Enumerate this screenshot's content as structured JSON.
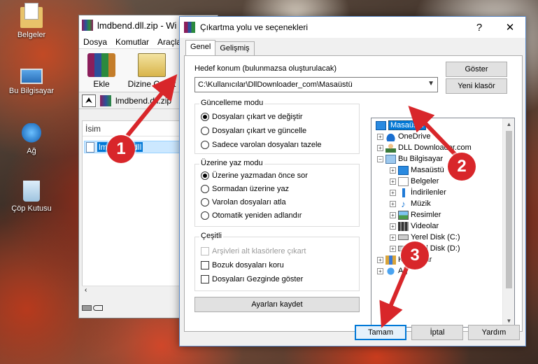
{
  "desktop": {
    "icons": [
      {
        "label": "Belgeler",
        "icon": "documents-folder-icon"
      },
      {
        "label": "Bu Bilgisayar",
        "icon": "this-pc-icon"
      },
      {
        "label": "Ağ",
        "icon": "network-icon"
      },
      {
        "label": "Çöp Kutusu",
        "icon": "recycle-bin-icon"
      }
    ]
  },
  "winrar": {
    "title": "lmdbend.dll.zip - Wi",
    "menu": [
      "Dosya",
      "Komutlar",
      "Araçla"
    ],
    "toolbar": {
      "add_label": "Ekle",
      "extract_label": "Dizine Çıkart"
    },
    "path": "lmdbend.dll.zip",
    "column_name": "İsim",
    "file": "lmdbend.dll"
  },
  "dialog": {
    "title": "Çıkartma yolu ve seçenekleri",
    "help_glyph": "?",
    "close_glyph": "✕",
    "tabs": [
      "Genel",
      "Gelişmiş"
    ],
    "destination": {
      "label": "Hedef konum (bulunmazsa oluşturulacak)",
      "value": "C:\\Kullanıcılar\\DllDownloader_com\\Masaüstü"
    },
    "buttons": {
      "show": "Göster",
      "new_folder": "Yeni klasör",
      "save_settings": "Ayarları kaydet",
      "ok": "Tamam",
      "cancel": "İptal",
      "help": "Yardım"
    },
    "update_mode": {
      "title": "Güncelleme modu",
      "options": [
        {
          "label": "Dosyaları çıkart ve değiştir",
          "selected": true
        },
        {
          "label": "Dosyaları çıkart ve güncelle",
          "selected": false
        },
        {
          "label": "Sadece varolan dosyaları tazele",
          "selected": false
        }
      ]
    },
    "overwrite_mode": {
      "title": "Üzerine yaz modu",
      "options": [
        {
          "label": "Üzerine yazmadan önce sor",
          "selected": true
        },
        {
          "label": "Sormadan üzerine yaz",
          "selected": false
        },
        {
          "label": "Varolan dosyaları atla",
          "selected": false
        },
        {
          "label": "Otomatik yeniden adlandır",
          "selected": false
        }
      ]
    },
    "misc": {
      "title": "Çeşitli",
      "options": [
        {
          "label": "Arşivleri alt klasörlere çıkart",
          "checked": false,
          "disabled": true
        },
        {
          "label": "Bozuk dosyaları koru",
          "checked": false,
          "disabled": false
        },
        {
          "label": "Dosyaları Gezginde göster",
          "checked": false,
          "disabled": false
        }
      ]
    },
    "tree": [
      {
        "label": "Masaüstü",
        "level": 0,
        "expander": "",
        "icon": "desktop-icon",
        "selected": true
      },
      {
        "label": "OneDrive",
        "level": 1,
        "expander": "+",
        "icon": "onedrive-icon"
      },
      {
        "label": "DLL Downloader.com",
        "level": 1,
        "expander": "+",
        "icon": "user-folder-icon"
      },
      {
        "label": "Bu Bilgisayar",
        "level": 1,
        "expander": "−",
        "icon": "this-pc-icon"
      },
      {
        "label": "Masaüstü",
        "level": 2,
        "expander": "+",
        "icon": "desktop-icon"
      },
      {
        "label": "Belgeler",
        "level": 2,
        "expander": "+",
        "icon": "documents-icon"
      },
      {
        "label": "İndirilenler",
        "level": 2,
        "expander": "+",
        "icon": "downloads-icon"
      },
      {
        "label": "Müzik",
        "level": 2,
        "expander": "+",
        "icon": "music-icon"
      },
      {
        "label": "Resimler",
        "level": 2,
        "expander": "+",
        "icon": "pictures-icon"
      },
      {
        "label": "Videolar",
        "level": 2,
        "expander": "+",
        "icon": "videos-icon"
      },
      {
        "label": "Yerel Disk (C:)",
        "level": 2,
        "expander": "+",
        "icon": "local-disk-icon"
      },
      {
        "label": "Yerel Disk (D:)",
        "level": 2,
        "expander": "+",
        "icon": "local-disk-icon"
      },
      {
        "label": "Kitaplıklar",
        "level": 1,
        "expander": "+",
        "icon": "libraries-icon"
      },
      {
        "label": "Ağ",
        "level": 1,
        "expander": "+",
        "icon": "network-icon"
      }
    ]
  },
  "annotations": [
    "1",
    "2",
    "3"
  ],
  "colors": {
    "annotation": "#d8262a",
    "selection": "#0078d7"
  }
}
